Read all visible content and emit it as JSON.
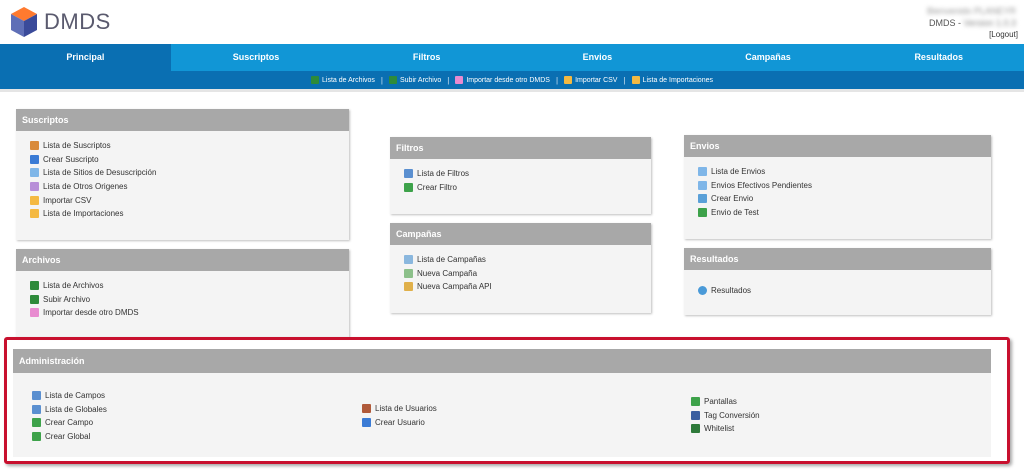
{
  "header": {
    "brand": "DMDS",
    "user_name": "Bienvenido PLANEYR",
    "version_prefix": "DMDS - ",
    "version_value": "Version 1.0.3",
    "logout": "[Logout]"
  },
  "nav": {
    "tabs": [
      "Principal",
      "Suscriptos",
      "Filtros",
      "Envios",
      "Campañas",
      "Resultados"
    ],
    "active": "Principal"
  },
  "subnav": {
    "items": [
      "Lista de Archivos",
      "Subir Archivo",
      "Importar desde otro DMDS",
      "Importar CSV",
      "Lista de Importaciones"
    ],
    "separator": "|"
  },
  "panels": {
    "suscriptos": {
      "title": "Suscriptos",
      "items": [
        "Lista de Suscriptos",
        "Crear Suscripto",
        "Lista de Sitios de Desuscripción",
        "Lista de Otros Origenes",
        "Importar CSV",
        "Lista de Importaciones"
      ]
    },
    "archivos": {
      "title": "Archivos",
      "items": [
        "Lista de Archivos",
        "Subir Archivo",
        "Importar desde otro DMDS"
      ]
    },
    "filtros": {
      "title": "Filtros",
      "items": [
        "Lista de Filtros",
        "Crear Filtro"
      ]
    },
    "campanas": {
      "title": "Campañas",
      "items": [
        "Lista de Campañas",
        "Nueva Campaña",
        "Nueva Campaña API"
      ]
    },
    "envios": {
      "title": "Envios",
      "items": [
        "Lista de Envios",
        "Envios Efectivos Pendientes",
        "Crear Envio",
        "Envio de Test"
      ]
    },
    "resultados": {
      "title": "Resultados",
      "items": [
        "Resultados"
      ]
    },
    "administracion": {
      "title": "Administración",
      "col1": [
        "Lista de Campos",
        "Lista de Globales",
        "Crear Campo",
        "Crear Global"
      ],
      "col2": [
        "Lista de Usuarios",
        "Crear Usuario"
      ],
      "col3": [
        "Pantallas",
        "Tag Conversión",
        "Whitelist"
      ]
    }
  },
  "colors": {
    "nav": "#1196d6",
    "nav_active": "#0a6fb2",
    "panel_head": "#a8a8a8",
    "highlight": "#c8102e"
  }
}
